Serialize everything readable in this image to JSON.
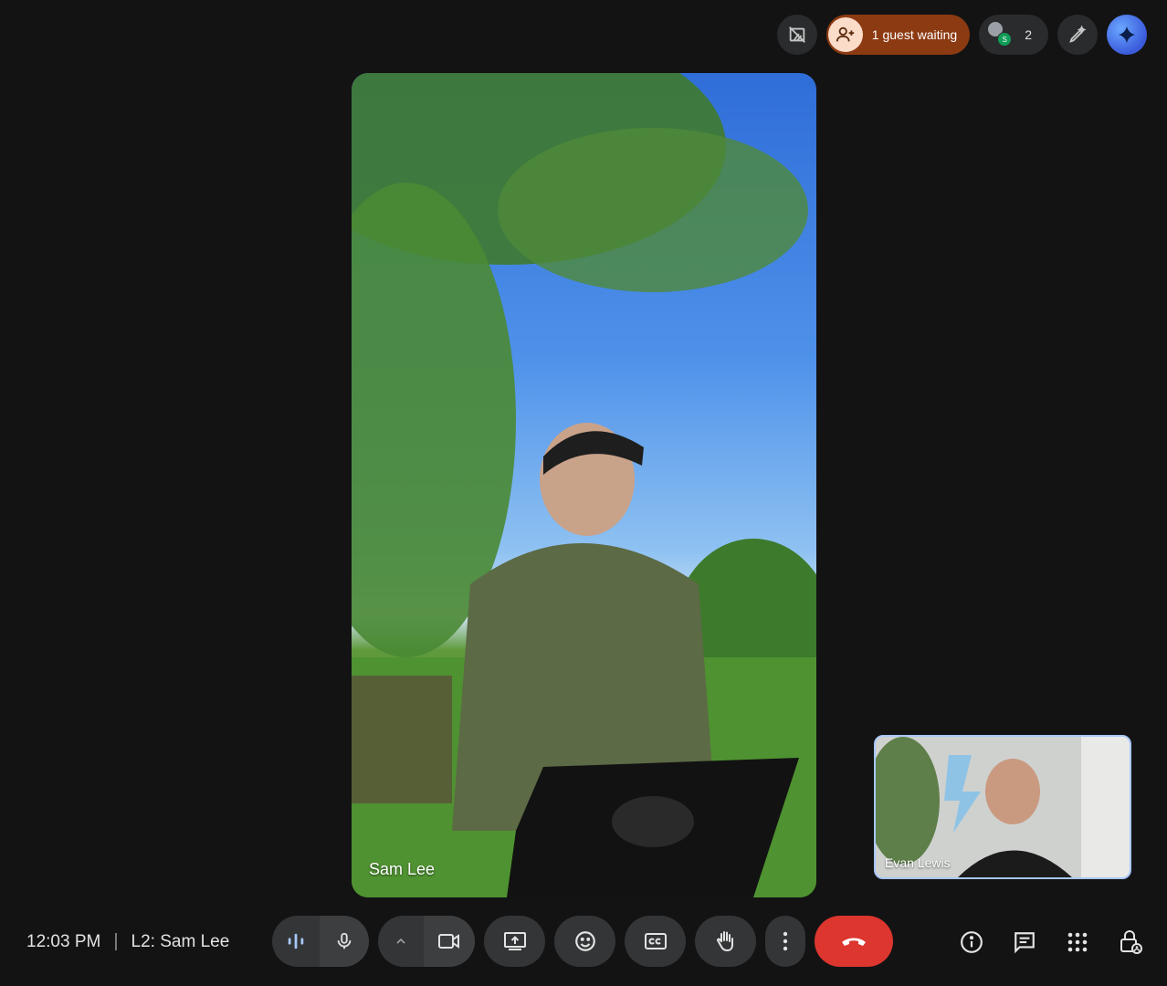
{
  "top_bar": {
    "guest_waiting_label": "1 guest waiting",
    "participant_count": "2",
    "participant_badge": "S"
  },
  "stage": {
    "main_participant_name": "Sam Lee",
    "self_participant_name": "Evan Lewis"
  },
  "meeting_info": {
    "time": "12:03 PM",
    "separator": "|",
    "meeting_title": "L2: Sam Lee"
  },
  "colors": {
    "background": "#131314",
    "chip": "#2a2b2d",
    "control": "#333537",
    "end_call": "#dc362e",
    "guest_chip": "#8c3a12",
    "self_border": "#a8c7fa"
  },
  "icons": {
    "top": [
      "no-background-icon",
      "add-person-icon",
      "avatar-icon",
      "edit-sparkle-icon",
      "gemini-icon"
    ],
    "controls": [
      "audio-level-icon",
      "microphone-icon",
      "chevron-up-icon",
      "camera-icon",
      "present-screen-icon",
      "emoji-icon",
      "captions-icon",
      "raise-hand-icon",
      "more-vert-icon",
      "hang-up-icon"
    ],
    "right": [
      "info-icon",
      "chat-icon",
      "apps-icon",
      "host-controls-icon"
    ]
  }
}
